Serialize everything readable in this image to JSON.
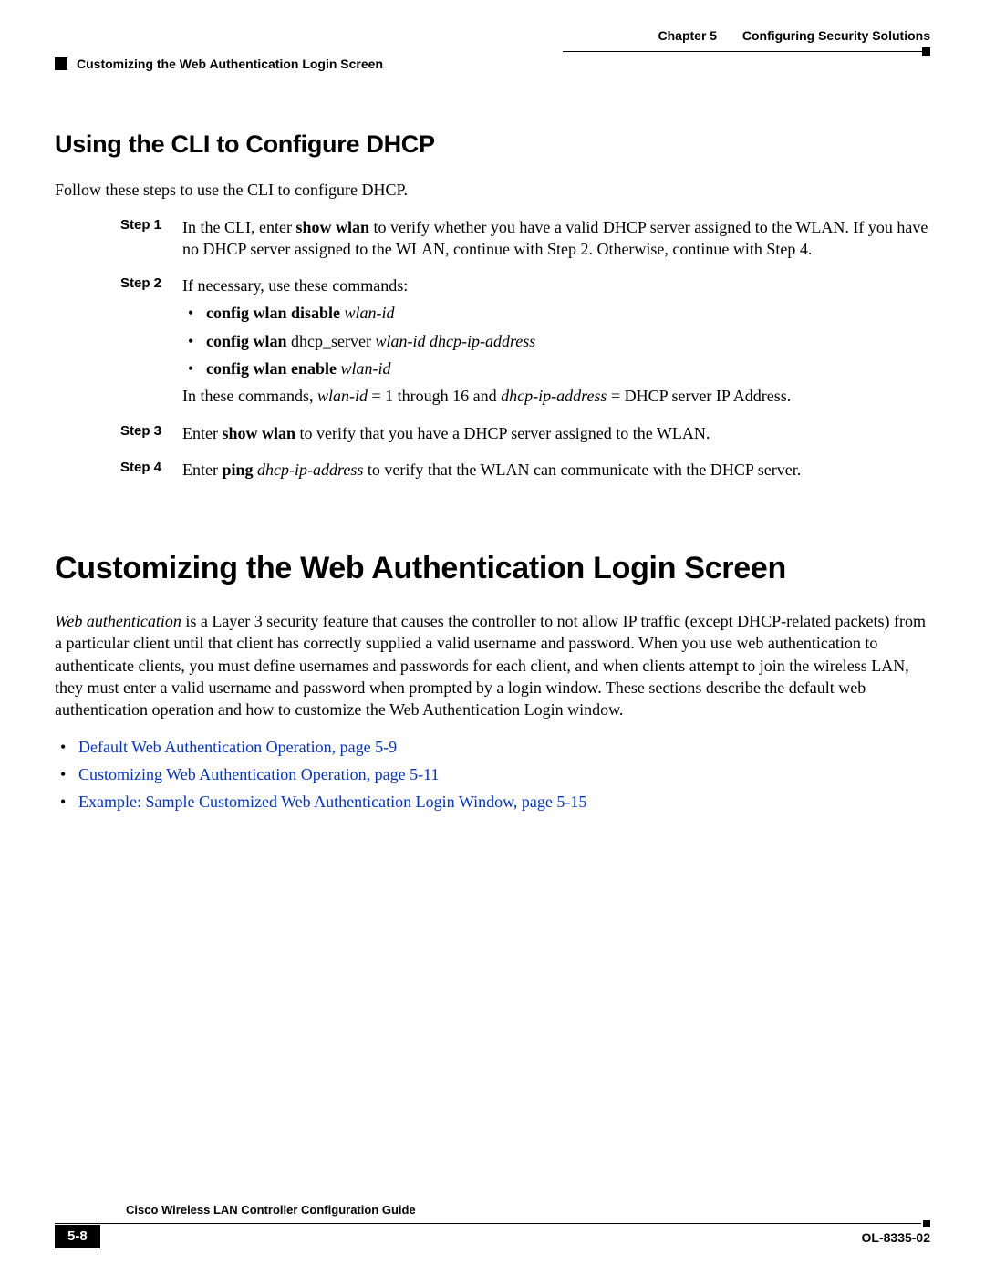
{
  "header": {
    "chapter_label": "Chapter 5",
    "chapter_title": "Configuring Security Solutions",
    "section_running": "Customizing the Web Authentication Login Screen"
  },
  "section_cli": {
    "heading": "Using the CLI to Configure DHCP",
    "intro": "Follow these steps to use the CLI to configure DHCP.",
    "steps": [
      {
        "label": "Step 1",
        "parts": {
          "pre": "In the CLI, enter ",
          "cmd1": "show wlan",
          "post": " to verify whether you have a valid DHCP server assigned to the WLAN. If you have no DHCP server assigned to the WLAN, continue with Step 2. Otherwise, continue with Step 4."
        }
      },
      {
        "label": "Step 2",
        "intro": "If necessary, use these commands:",
        "bullets": [
          {
            "bold": "config wlan disable ",
            "italic": "wlan-id"
          },
          {
            "bold": "config wlan ",
            "plain": "dhcp_server ",
            "italic": "wlan-id dhcp-ip-address"
          },
          {
            "bold": "config wlan enable ",
            "italic": "wlan-id"
          }
        ],
        "trailing": {
          "t1": "In these commands, ",
          "i1": "wlan-id",
          "t2": " = 1 through 16 and ",
          "i2": "dhcp-ip-address",
          "t3": " = DHCP server IP Address."
        }
      },
      {
        "label": "Step 3",
        "parts": {
          "pre": "Enter ",
          "cmd1": "show wlan",
          "post": " to verify that you have a DHCP server assigned to the WLAN."
        }
      },
      {
        "label": "Step 4",
        "parts": {
          "pre": "Enter ",
          "cmd1": "ping ",
          "arg": "dhcp-ip-address",
          "post": " to verify that the WLAN can communicate with the DHCP server."
        }
      }
    ]
  },
  "section_custom": {
    "heading": "Customizing the Web Authentication Login Screen",
    "para": {
      "i1": "Web authentication",
      "t": " is a Layer 3 security feature that causes the controller to not allow IP traffic (except DHCP-related packets) from a particular client until that client has correctly supplied a valid username and password. When you use web authentication to authenticate clients, you must define usernames and passwords for each client, and when clients attempt to join the wireless LAN, they must enter a valid username and password when prompted by a login window. These sections describe the default web authentication operation and how to customize the Web Authentication Login window."
    },
    "links": [
      "Default Web Authentication Operation, page 5-9",
      "Customizing Web Authentication Operation, page 5-11",
      "Example: Sample Customized Web Authentication Login Window, page 5-15"
    ]
  },
  "footer": {
    "guide_title": "Cisco Wireless LAN Controller Configuration Guide",
    "page_num": "5-8",
    "doc_id": "OL-8335-02"
  }
}
